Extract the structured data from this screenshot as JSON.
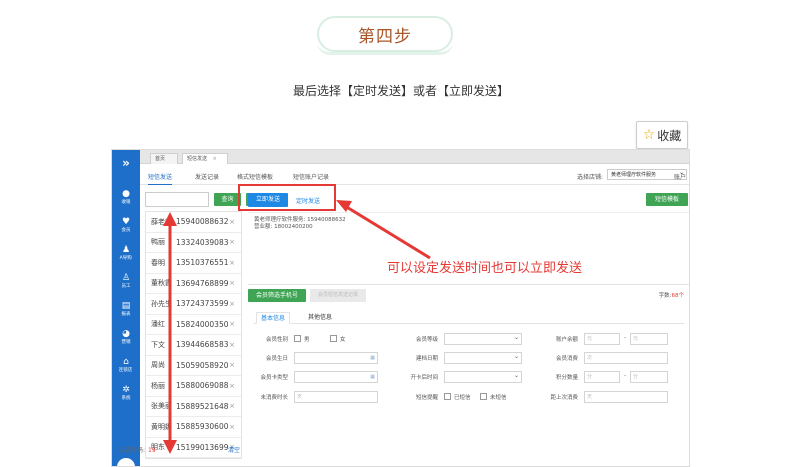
{
  "header": {
    "step_label": "第四步",
    "subtitle": "最后选择【定时发送】或者【立即发送】"
  },
  "favorite": {
    "label": "收藏",
    "icon": "star-icon"
  },
  "annotation": {
    "text": "可以设定发送时间也可以立即发送",
    "color": "#e53935"
  },
  "app": {
    "sidebar": {
      "toggle": "»",
      "items": [
        {
          "label": "收银",
          "icon": "cash-icon"
        },
        {
          "label": "会员",
          "icon": "heart-icon"
        },
        {
          "label": "A导购",
          "icon": "person-icon"
        },
        {
          "label": "员工",
          "icon": "staff-icon"
        },
        {
          "label": "报表",
          "icon": "report-icon"
        },
        {
          "label": "营销",
          "icon": "pie-icon"
        },
        {
          "label": "连锁店",
          "icon": "store-icon"
        },
        {
          "label": "系统",
          "icon": "gear-icon"
        }
      ]
    },
    "tabs": [
      {
        "label": "首页"
      },
      {
        "label": "短信发送"
      }
    ],
    "tab_close": "×",
    "subnav": {
      "items": [
        "短信发送",
        "发送记录",
        "格式短信模板",
        "短信账户记录"
      ],
      "store_label": "选择店铺:",
      "store_value": "黄老师理疗软件服务",
      "account": "账户"
    },
    "left": {
      "search_button": "查询",
      "import_button": "导入",
      "contacts": [
        {
          "name": "薛老师",
          "phone": "15940088632"
        },
        {
          "name": "鸭丽",
          "phone": "13324039083"
        },
        {
          "name": "春明",
          "phone": "13510376551"
        },
        {
          "name": "董秋霞",
          "phone": "13694768899"
        },
        {
          "name": "孙先生",
          "phone": "13724373599"
        },
        {
          "name": "潘红",
          "phone": "15824000350"
        },
        {
          "name": "下文",
          "phone": "13944668583"
        },
        {
          "name": "周尚",
          "phone": "15059058920"
        },
        {
          "name": "杨丽",
          "phone": "15880069088"
        },
        {
          "name": "张美丽",
          "phone": "15889521648"
        },
        {
          "name": "黄明娜",
          "phone": "15885930600"
        },
        {
          "name": "明东",
          "phone": "15199013699"
        }
      ],
      "remove_glyph": "×",
      "selected_label": "已选号码:",
      "selected_count": "19",
      "clear_label": "清空"
    },
    "main": {
      "send_now": "立即发送",
      "send_timed": "定时发送",
      "template_button": "短信模板",
      "message_line1": "黄老师理疗软件服务: 15940088632",
      "message_line2": "营业额: 18002400200",
      "filter_tab": "会员筛选手机号",
      "filter_tab_ghost": "会员短信发送记录",
      "filter_right_label": "字数:",
      "filter_right_count": "68个",
      "inner_tab_basic": "基本信息",
      "inner_tab_other": "其他信息",
      "fields": {
        "gender": "会员性别",
        "male": "男",
        "female": "女",
        "birthday": "会员生日",
        "card_type": "会员卡类型",
        "last_consume": "未消费时长",
        "card_level": "会员等级",
        "create_date": "建档日期",
        "card_date": "开卡后时间",
        "activation": "短信提醒",
        "activated": "已短信",
        "unactivated": "未短信",
        "balance": "账户余额",
        "balance_from": "元",
        "balance_to": "元",
        "consume_count": "会员消费",
        "consume_placeholder": "次",
        "points": "积分数量",
        "points_from": "分",
        "points_to": "分",
        "last_visit": "距上次消费",
        "last_visit_placeholder": "天",
        "duration_placeholder": "天",
        "range_sep": "- "
      }
    }
  }
}
